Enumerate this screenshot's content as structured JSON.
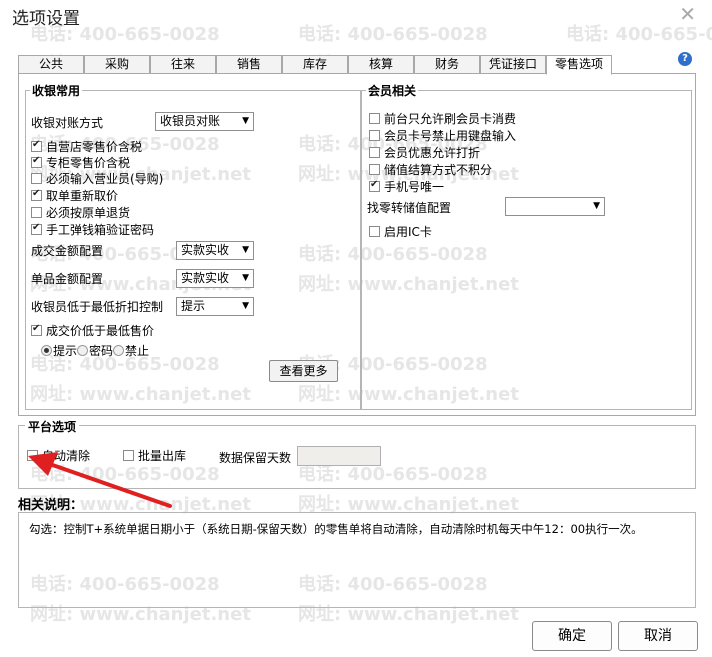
{
  "window": {
    "title": "选项设置"
  },
  "watermark": {
    "phone": "电话: 400-665-0028",
    "site": "网址: www.chanjet.net"
  },
  "tabs": [
    {
      "label": "公共"
    },
    {
      "label": "采购"
    },
    {
      "label": "往来"
    },
    {
      "label": "销售"
    },
    {
      "label": "库存"
    },
    {
      "label": "核算"
    },
    {
      "label": "财务"
    },
    {
      "label": "凭证接口"
    },
    {
      "label": "零售选项"
    }
  ],
  "cashier": {
    "legend": "收银常用",
    "reconcile_label": "收银对账方式",
    "reconcile_value": "收银员对账",
    "checks": [
      {
        "label": "自营店零售价含税",
        "checked": true
      },
      {
        "label": "专柜零售价含税",
        "checked": true
      },
      {
        "label": "必须输入营业员(导购)",
        "checked": false
      },
      {
        "label": "取单重新取价",
        "checked": true
      },
      {
        "label": "必须按原单退货",
        "checked": false
      },
      {
        "label": "手工弹钱箱验证密码",
        "checked": true
      }
    ],
    "deal_amount_label": "成交金额配置",
    "deal_amount_value": "实款实收",
    "item_amount_label": "单品金额配置",
    "item_amount_value": "实款实收",
    "min_discount_label": "收银员低于最低折扣控制",
    "min_discount_value": "提示",
    "min_price_label": "成交价低于最低售价",
    "min_price_checked": true,
    "radios": [
      {
        "label": "提示",
        "selected": true
      },
      {
        "label": "密码",
        "selected": false
      },
      {
        "label": "禁止",
        "selected": false
      }
    ],
    "more_button": "查看更多"
  },
  "member": {
    "legend": "会员相关",
    "checks": [
      {
        "label": "前台只允许刷会员卡消费",
        "checked": false
      },
      {
        "label": "会员卡号禁止用键盘输入",
        "checked": false
      },
      {
        "label": "会员优惠允许打折",
        "checked": false
      },
      {
        "label": "储值结算方式不积分",
        "checked": false
      },
      {
        "label": "手机号唯一",
        "checked": true
      }
    ],
    "change_label": "找零转储值配置",
    "change_value": "",
    "ic_label": "启用IC卡",
    "ic_checked": false
  },
  "platform": {
    "legend": "平台选项",
    "auto_clear_label": "自动清除",
    "auto_clear_checked": false,
    "batch_out_label": "批量出库",
    "batch_out_checked": false,
    "retain_days_label": "数据保留天数",
    "retain_days_value": ""
  },
  "description": {
    "label": "相关说明：",
    "text": "勾选：控制T+系统单据日期小于（系统日期-保留天数）的零售单将自动清除，自动清除时机每天中午12：00执行一次。"
  },
  "buttons": {
    "ok": "确定",
    "cancel": "取消"
  },
  "colors": {
    "annotation_arrow": "#e02020",
    "help_icon": "#2e6fc9"
  }
}
